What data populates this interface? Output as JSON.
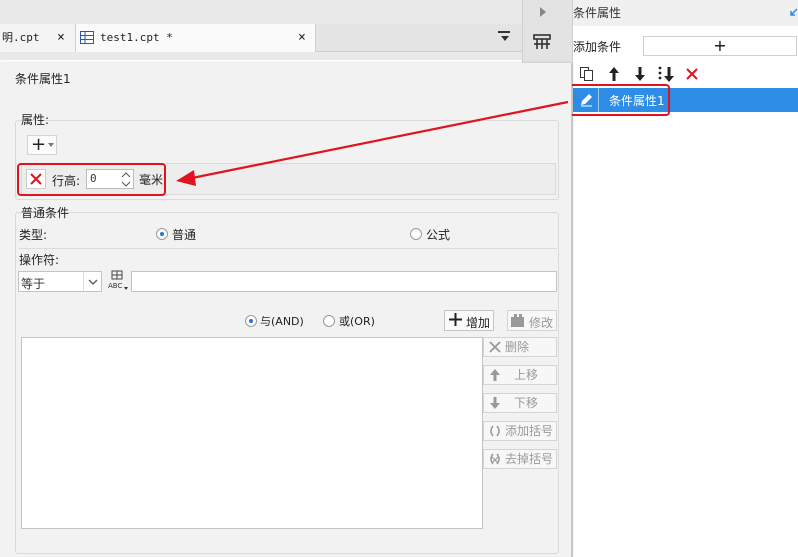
{
  "tabs": [
    {
      "label": "明.cpt",
      "close": "×"
    },
    {
      "label": "test1.cpt *",
      "close": "×"
    }
  ],
  "right_panel": {
    "title": "条件属性",
    "add_condition_label": "添加条件",
    "add_icon": "+",
    "selected_item": "条件属性1"
  },
  "dialog": {
    "title": "条件属性1",
    "attribute_label": "属性:",
    "add_attr_icon": "+",
    "row_height_label": "行高:",
    "row_height_value": "0",
    "unit_label": "毫米",
    "normal_condition_label": "普通条件",
    "type_label": "类型:",
    "type_options": [
      "普通",
      "公式"
    ],
    "type_selected": "普通",
    "operator_label": "操作符:",
    "operator_value": "等于",
    "value_input": "",
    "and_label": "与(AND)",
    "or_label": "或(OR)",
    "logic_selected": "与(AND)",
    "add_button": "增加",
    "modify_button": "修改",
    "delete_button": "删除",
    "move_up_button": "上移",
    "move_down_button": "下移",
    "add_bracket_button": "添加括号",
    "remove_bracket_button": "去掉括号"
  },
  "colors": {
    "accent": "#2d8ce6",
    "highlight_red": "#e0141e",
    "dialog_bg": "#f2f2f2"
  }
}
